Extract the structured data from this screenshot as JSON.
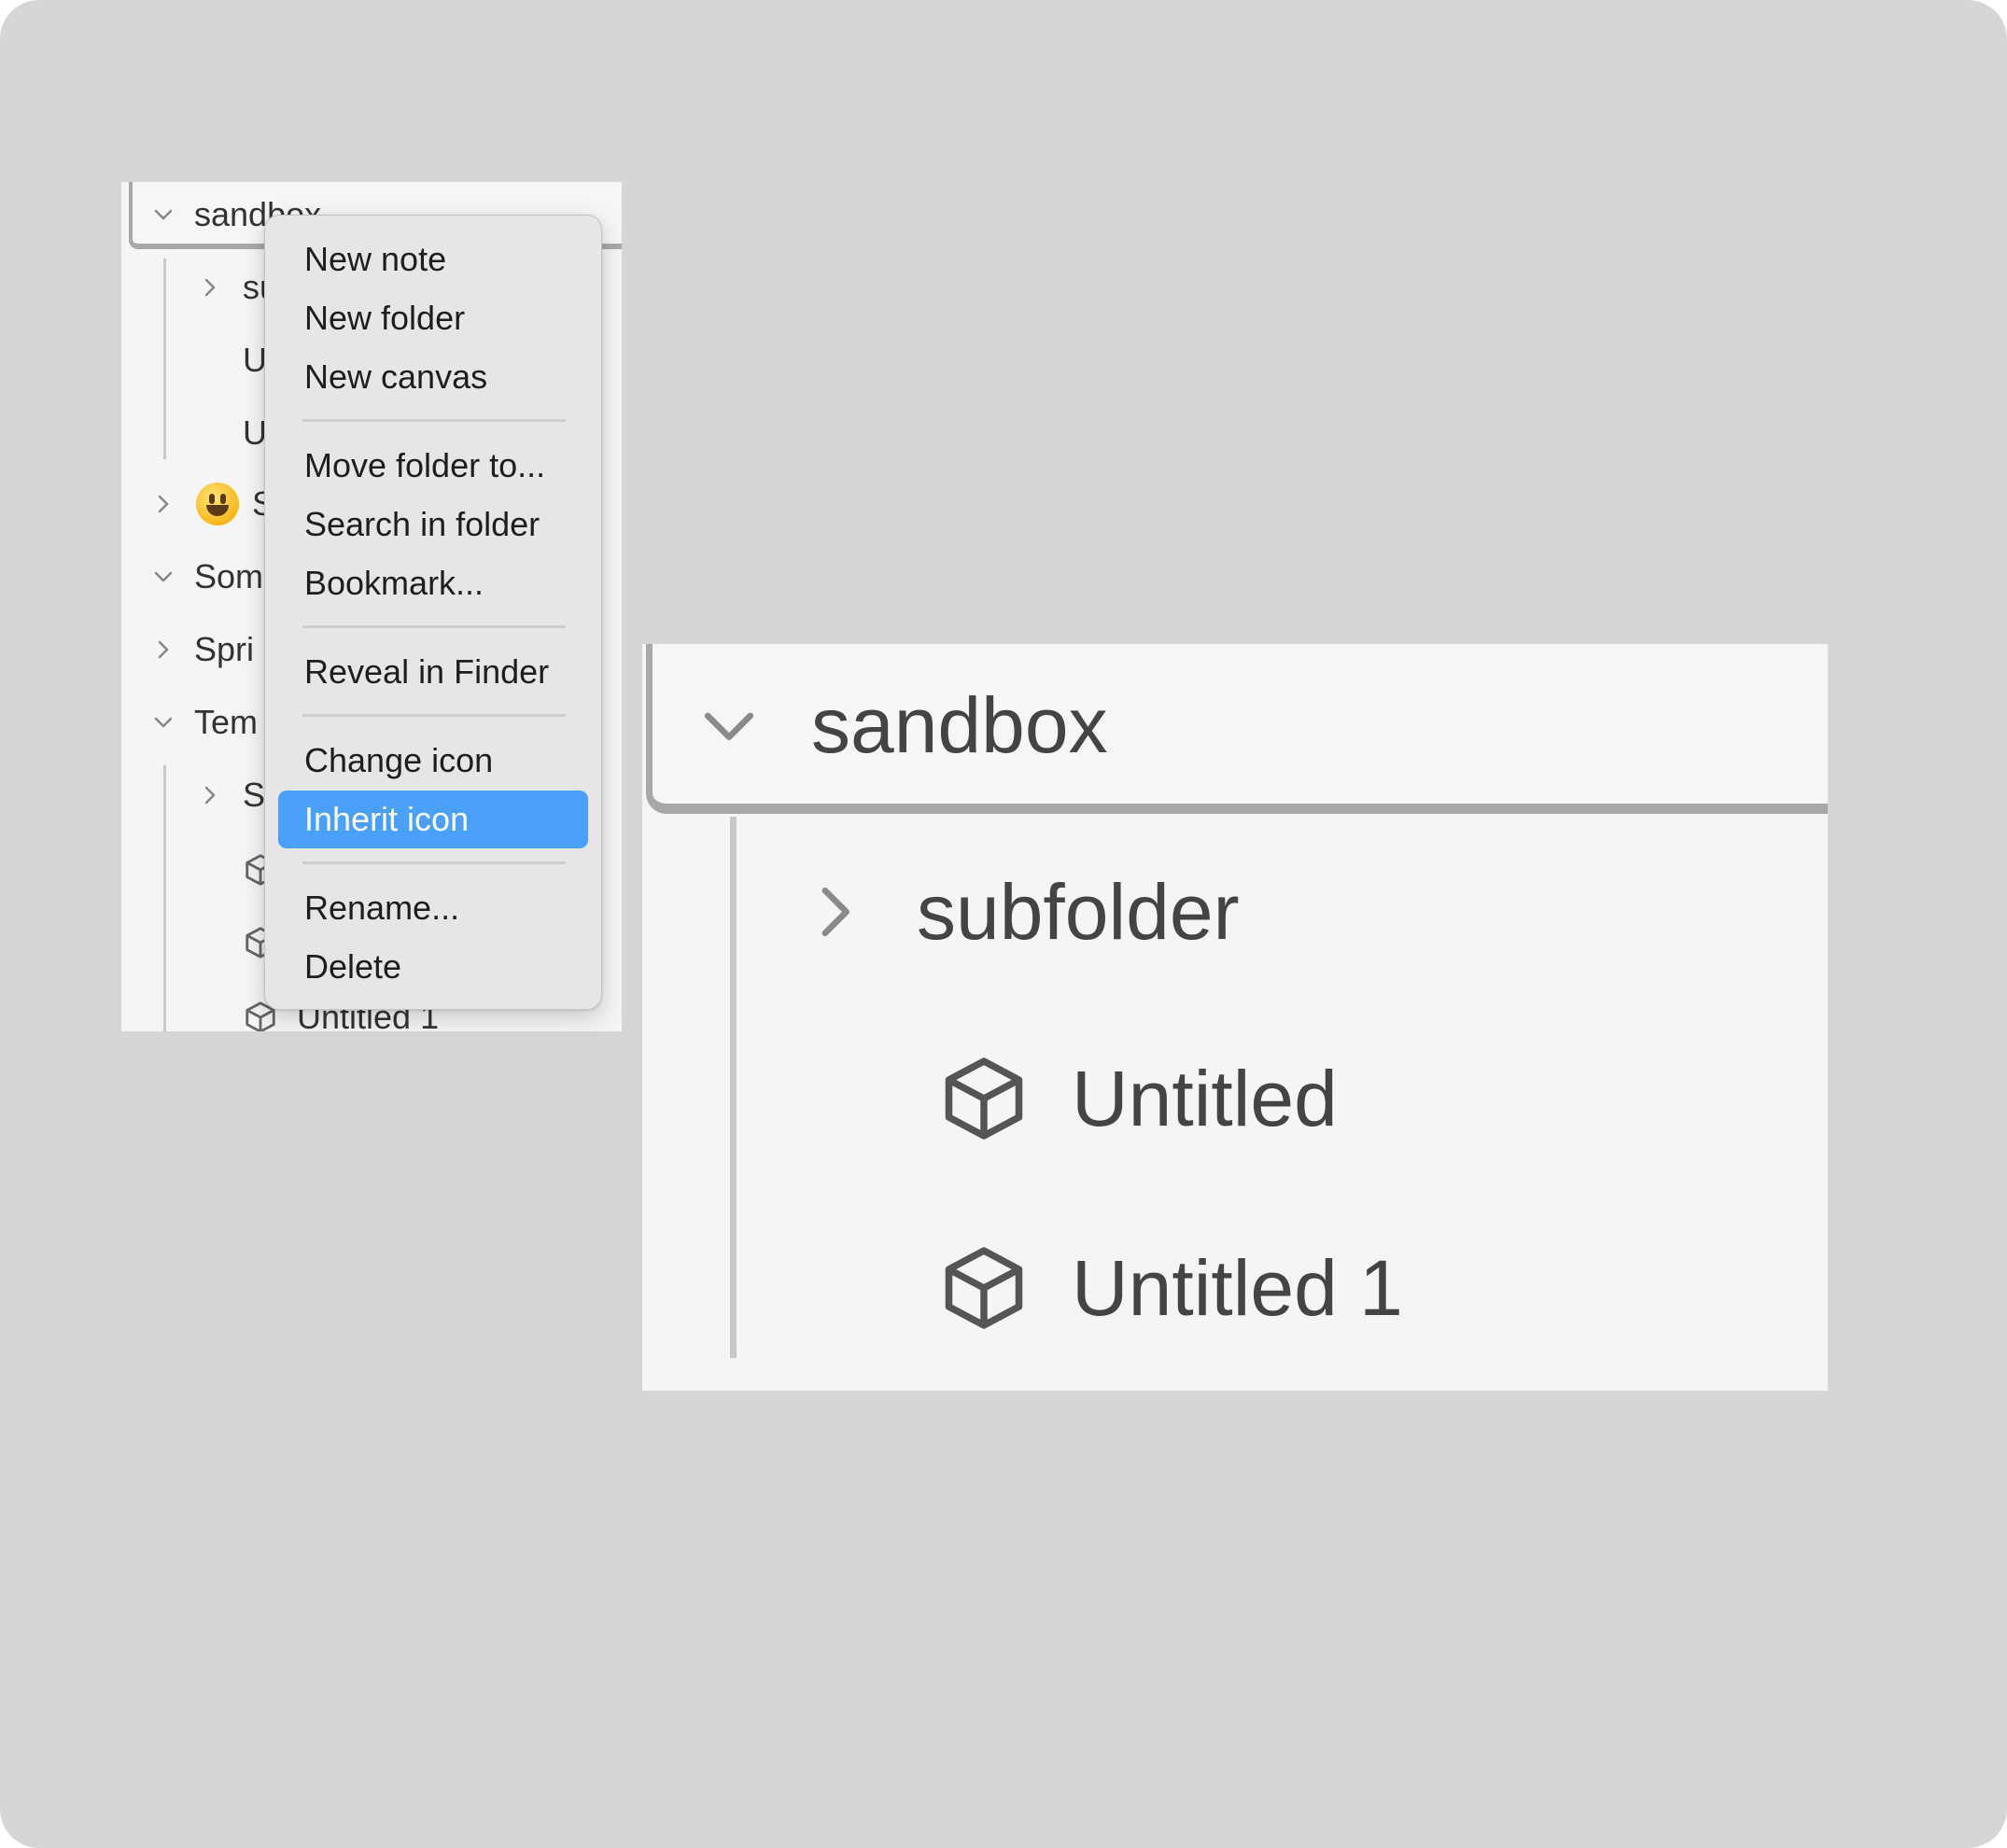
{
  "explorer": {
    "root_folder": "sandbox",
    "children": [
      {
        "label": "subfolder",
        "type": "folder",
        "expanded": false
      },
      {
        "label": "Untitled",
        "type": "note"
      },
      {
        "label": "Untitled 1",
        "type": "note"
      }
    ],
    "partial_rows": [
      "su",
      "U",
      "U",
      "S",
      "Som",
      "Spri",
      "Tem",
      "S"
    ],
    "bottom_label": "Untitled 1"
  },
  "context_menu": {
    "items": [
      {
        "label": "New note"
      },
      {
        "label": "New folder"
      },
      {
        "label": "New canvas"
      },
      {
        "label": "Move folder to..."
      },
      {
        "label": "Search in folder"
      },
      {
        "label": "Bookmark..."
      },
      {
        "label": "Reveal in Finder"
      },
      {
        "label": "Change icon"
      },
      {
        "label": "Inherit icon",
        "highlighted": true
      },
      {
        "label": "Rename..."
      },
      {
        "label": "Delete"
      }
    ]
  },
  "icons": {
    "chevron_down": "chevron-down-icon",
    "chevron_right": "chevron-right-icon",
    "note": "cube-icon",
    "emoji": "smiley-emoji-icon"
  },
  "colors": {
    "background": "#d6d6d6",
    "panel": "#f5f5f5",
    "menu": "#e6e6e6",
    "highlight": "#4a9ff8",
    "active_border": "#a9a9a9"
  }
}
